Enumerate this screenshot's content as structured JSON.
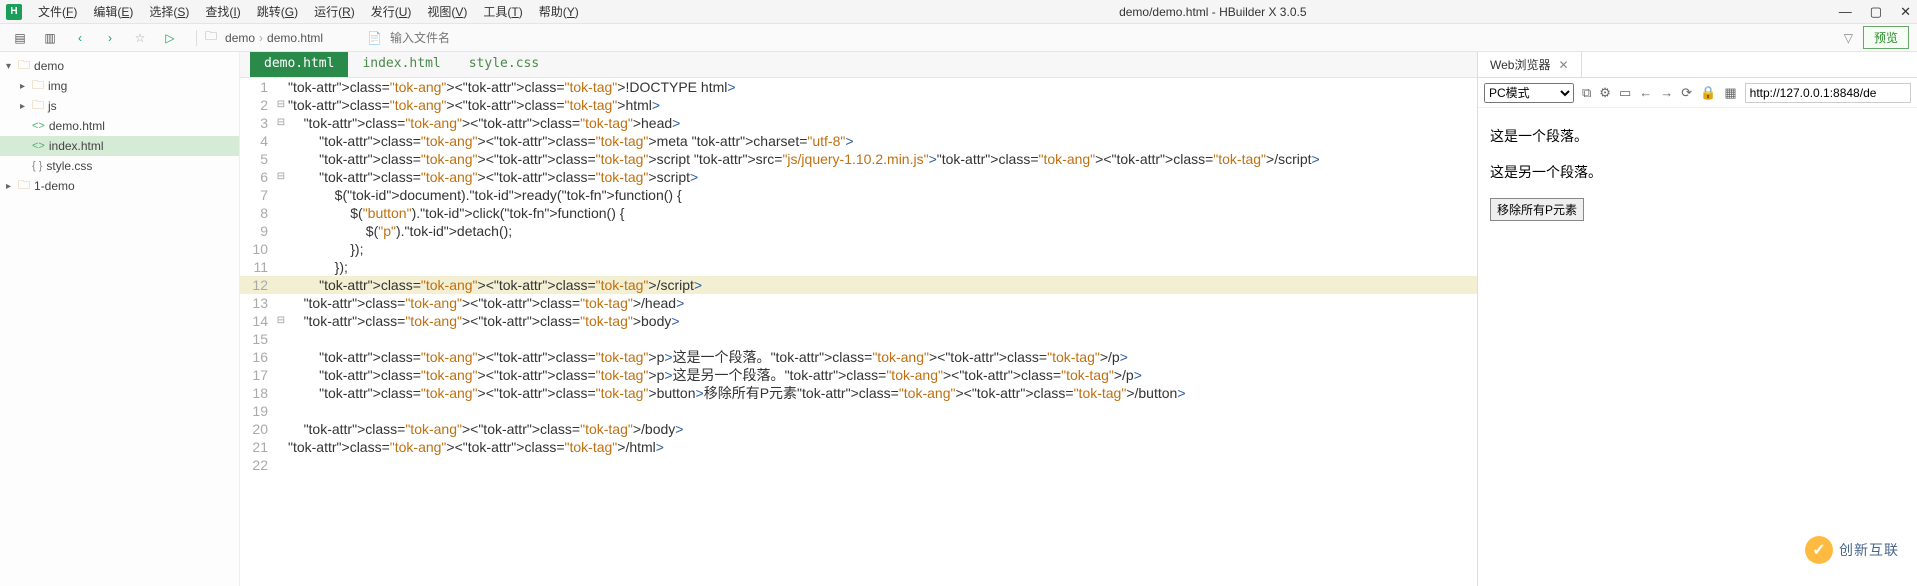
{
  "app": {
    "logo_text": "H",
    "title": "demo/demo.html - HBuilder X 3.0.5"
  },
  "menu": {
    "items": [
      {
        "label": "文件",
        "key": "F"
      },
      {
        "label": "编辑",
        "key": "E"
      },
      {
        "label": "选择",
        "key": "S"
      },
      {
        "label": "查找",
        "key": "I"
      },
      {
        "label": "跳转",
        "key": "G"
      },
      {
        "label": "运行",
        "key": "R"
      },
      {
        "label": "发行",
        "key": "U"
      },
      {
        "label": "视图",
        "key": "V"
      },
      {
        "label": "工具",
        "key": "T"
      },
      {
        "label": "帮助",
        "key": "Y"
      }
    ]
  },
  "toolbar": {
    "breadcrumbs": [
      "demo",
      "demo.html"
    ],
    "file_input_placeholder": "输入文件名",
    "preview_label": "预览"
  },
  "sidebar": {
    "tree": [
      {
        "type": "folder",
        "label": "demo",
        "indent": 0,
        "expanded": true
      },
      {
        "type": "folder",
        "label": "img",
        "indent": 1,
        "expanded": false
      },
      {
        "type": "folder",
        "label": "js",
        "indent": 1,
        "expanded": false
      },
      {
        "type": "html",
        "label": "demo.html",
        "indent": 1
      },
      {
        "type": "html",
        "label": "index.html",
        "indent": 1,
        "active": true
      },
      {
        "type": "css",
        "label": "style.css",
        "indent": 1
      },
      {
        "type": "folder",
        "label": "1-demo",
        "indent": 0,
        "expanded": false
      }
    ]
  },
  "editor": {
    "tabs": [
      "demo.html",
      "index.html",
      "style.css"
    ],
    "active_tab": 0,
    "highlighted_line": 12,
    "code_lines": [
      {
        "n": 1,
        "fold": "",
        "raw": "<!DOCTYPE html>"
      },
      {
        "n": 2,
        "fold": "⊟",
        "raw": "<html>"
      },
      {
        "n": 3,
        "fold": "⊟",
        "raw": "    <head>"
      },
      {
        "n": 4,
        "fold": "",
        "raw": "        <meta charset=\"utf-8\">"
      },
      {
        "n": 5,
        "fold": "",
        "raw": "        <script src=\"js/jquery-1.10.2.min.js\"></script>"
      },
      {
        "n": 6,
        "fold": "⊟",
        "raw": "        <script>"
      },
      {
        "n": 7,
        "fold": "",
        "raw": "            $(document).ready(function() {"
      },
      {
        "n": 8,
        "fold": "",
        "raw": "                $(\"button\").click(function() {"
      },
      {
        "n": 9,
        "fold": "",
        "raw": "                    $(\"p\").detach();"
      },
      {
        "n": 10,
        "fold": "",
        "raw": "                });"
      },
      {
        "n": 11,
        "fold": "",
        "raw": "            });"
      },
      {
        "n": 12,
        "fold": "",
        "raw": "        </script>"
      },
      {
        "n": 13,
        "fold": "",
        "raw": "    </head>"
      },
      {
        "n": 14,
        "fold": "⊟",
        "raw": "    <body>"
      },
      {
        "n": 15,
        "fold": "",
        "raw": ""
      },
      {
        "n": 16,
        "fold": "",
        "raw": "        <p>这是一个段落。</p>"
      },
      {
        "n": 17,
        "fold": "",
        "raw": "        <p>这是另一个段落。</p>"
      },
      {
        "n": 18,
        "fold": "",
        "raw": "        <button>移除所有P元素</button>"
      },
      {
        "n": 19,
        "fold": "",
        "raw": ""
      },
      {
        "n": 20,
        "fold": "",
        "raw": "    </body>"
      },
      {
        "n": 21,
        "fold": "",
        "raw": "</html>"
      },
      {
        "n": 22,
        "fold": "",
        "raw": ""
      }
    ]
  },
  "browser": {
    "tab_title": "Web浏览器",
    "mode": "PC模式",
    "url": "http://127.0.0.1:8848/de",
    "paragraph1": "这是一个段落。",
    "paragraph2": "这是另一个段落。",
    "button_label": "移除所有P元素"
  },
  "watermark": {
    "text": "创新互联"
  }
}
